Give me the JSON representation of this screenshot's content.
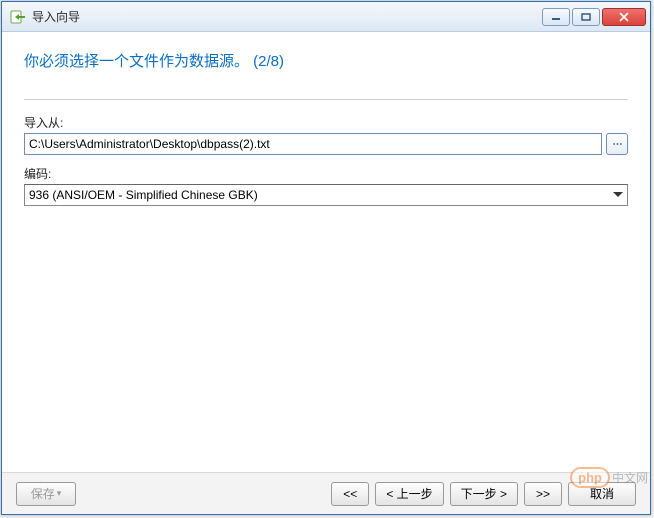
{
  "window": {
    "title": "导入向导"
  },
  "heading": "你必须选择一个文件作为数据源。 (2/8)",
  "form": {
    "import_from_label": "导入从:",
    "import_from_value": "C:\\Users\\Administrator\\Desktop\\dbpass(2).txt",
    "browse_glyph": "⋯",
    "encoding_label": "编码:",
    "encoding_value": "936 (ANSI/OEM - Simplified Chinese GBK)"
  },
  "footer": {
    "save_label": "保存",
    "first_label": "<<",
    "prev_label": "< 上一步",
    "next_label": "下一步 >",
    "last_label": ">>",
    "cancel_label": "取消"
  },
  "watermark": {
    "brand_p": "php",
    "brand_rest": "中文网"
  }
}
